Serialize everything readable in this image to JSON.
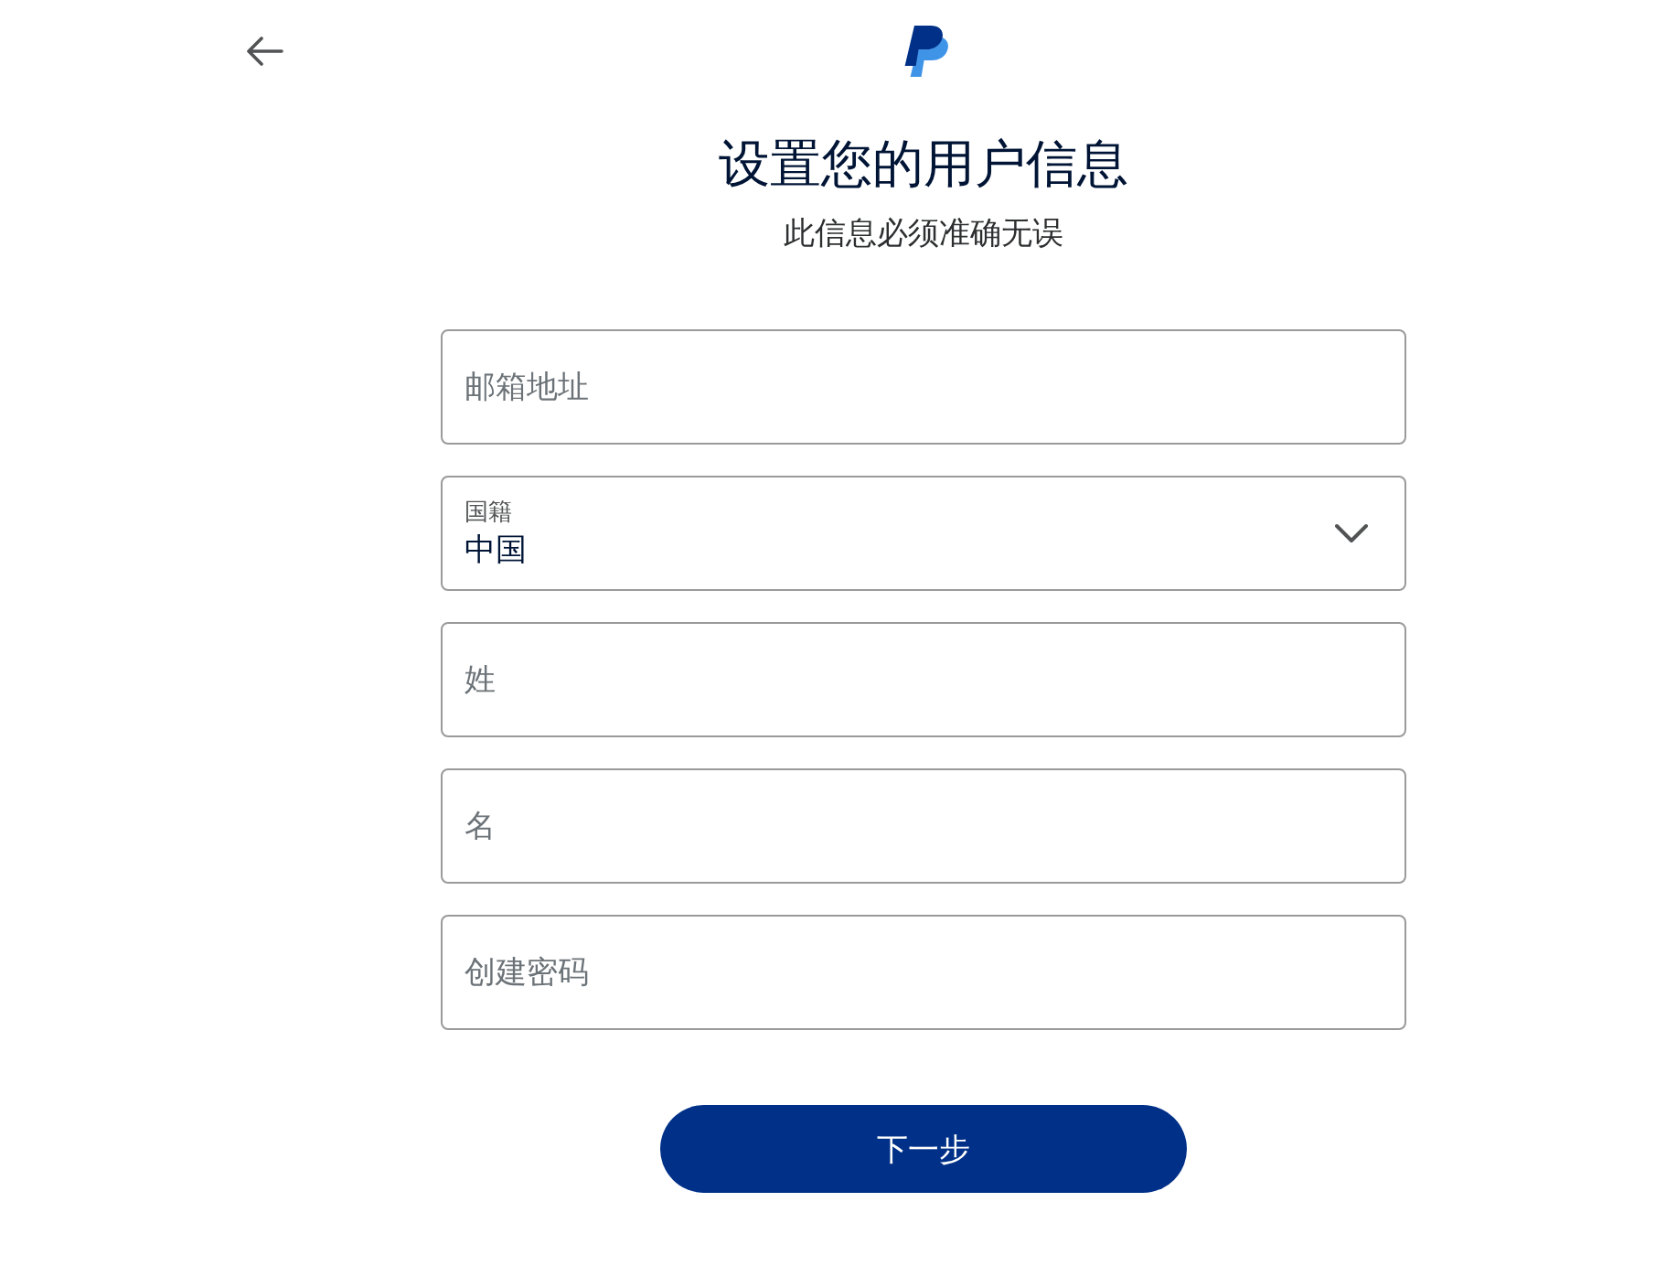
{
  "header": {
    "back_button": {
      "kind": "back"
    },
    "logo": {
      "kind": "mark"
    }
  },
  "heading": {
    "title": "设置您的用户信息",
    "subtitle": "此信息必须准确无误"
  },
  "fields": [
    {
      "kind": "text",
      "placeholder": "邮箱地址"
    },
    {
      "kind": "select",
      "label": "国籍",
      "value": "中国"
    },
    {
      "kind": "text",
      "placeholder": "姓"
    },
    {
      "kind": "text",
      "placeholder": "名"
    },
    {
      "kind": "password",
      "placeholder": "创建密码"
    }
  ],
  "next_button": {
    "label": "下一步"
  }
}
